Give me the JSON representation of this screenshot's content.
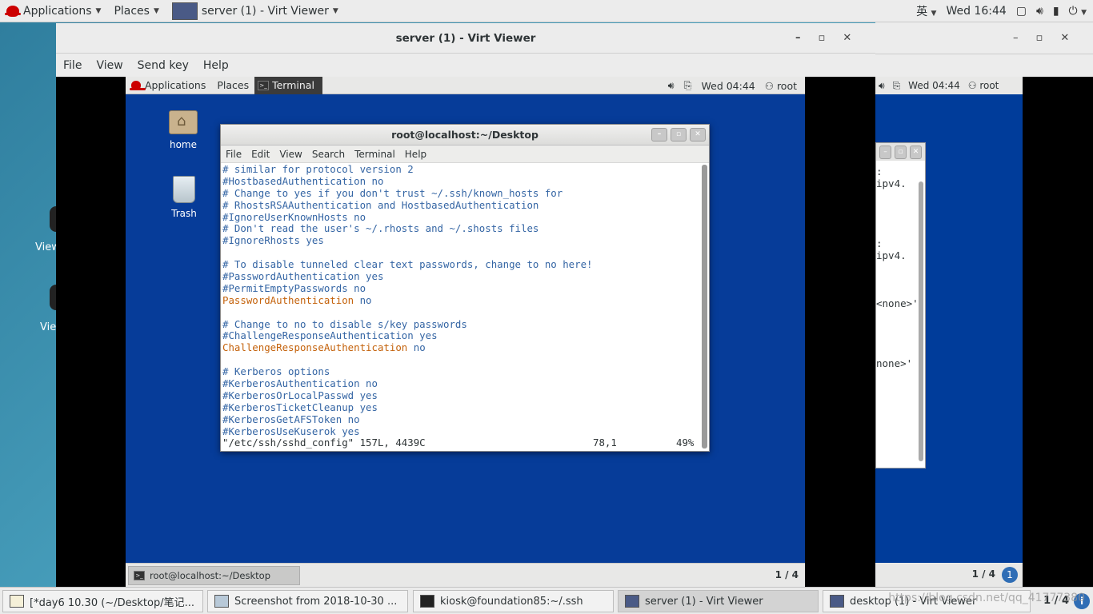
{
  "host": {
    "topbar": {
      "applications": "Applications",
      "places": "Places",
      "active_window": "server (1) - Virt Viewer",
      "input_method": "英",
      "clock": "Wed 16:44"
    },
    "desktop_fragments": [
      "View",
      "Vie"
    ],
    "taskbar": {
      "items": [
        "[*day6 10.30 (~/Desktop/笔记...",
        "Screenshot from 2018-10-30 ...",
        "kiosk@foundation85:~/.ssh",
        "server (1) - Virt Viewer",
        "desktop (1) - Virt Viewer"
      ],
      "workspace": "1 / 4",
      "watermark": "https://blog.csdn.net/qq_41777380"
    }
  },
  "viewer": {
    "title": "server (1) - Virt Viewer",
    "menu": [
      "File",
      "View",
      "Send key",
      "Help"
    ]
  },
  "guest": {
    "topbar": {
      "applications": "Applications",
      "places": "Places",
      "task": "Terminal",
      "clock": "Wed 04:44",
      "user": "root"
    },
    "desktop_icons": [
      "home",
      "Trash"
    ],
    "terminal": {
      "title": "root@localhost:~/Desktop",
      "menu": [
        "File",
        "Edit",
        "View",
        "Search",
        "Terminal",
        "Help"
      ],
      "lines": [
        {
          "k": "c",
          "t": "# similar for protocol version 2"
        },
        {
          "k": "c",
          "t": "#HostbasedAuthentication no"
        },
        {
          "k": "c",
          "t": "# Change to yes if you don't trust ~/.ssh/known_hosts for"
        },
        {
          "k": "c",
          "t": "# RhostsRSAAuthentication and HostbasedAuthentication"
        },
        {
          "k": "c",
          "t": "#IgnoreUserKnownHosts no"
        },
        {
          "k": "c",
          "t": "# Don't read the user's ~/.rhosts and ~/.shosts files"
        },
        {
          "k": "c",
          "t": "#IgnoreRhosts yes"
        },
        {
          "k": "b",
          "t": ""
        },
        {
          "k": "c",
          "t": "# To disable tunneled clear text passwords, change to no here!"
        },
        {
          "k": "c",
          "t": "#PasswordAuthentication yes"
        },
        {
          "k": "c",
          "t": "#PermitEmptyPasswords no"
        },
        {
          "k": "kv",
          "t": "PasswordAuthentication",
          "v": "no"
        },
        {
          "k": "b",
          "t": ""
        },
        {
          "k": "c",
          "t": "# Change to no to disable s/key passwords"
        },
        {
          "k": "c",
          "t": "#ChallengeResponseAuthentication yes"
        },
        {
          "k": "kv",
          "t": "ChallengeResponseAuthentication",
          "v": "no"
        },
        {
          "k": "b",
          "t": ""
        },
        {
          "k": "c",
          "t": "# Kerberos options"
        },
        {
          "k": "c",
          "t": "#KerberosAuthentication no"
        },
        {
          "k": "c",
          "t": "#KerberosOrLocalPasswd yes"
        },
        {
          "k": "c",
          "t": "#KerberosTicketCleanup yes"
        },
        {
          "k": "c",
          "t": "#KerberosGetAFSToken no"
        },
        {
          "k": "c",
          "t": "#KerberosUseKuserok yes"
        }
      ],
      "status_file": "\"/etc/ssh/sshd_config\" 157L, 4439C",
      "status_pos": "78,1",
      "status_pct": "49%",
      "scroll_position_fraction": 0.49
    },
    "taskbar": {
      "task": "root@localhost:~/Desktop",
      "workspace": "1 / 4"
    }
  },
  "viewer2": {
    "clock": "Wed 04:44",
    "user": "root",
    "workspace": "1 / 4",
    "term_fragments": [
      ": ipv4.",
      "",
      "",
      "",
      "",
      ": ipv4.",
      "",
      "",
      "",
      "<none>'",
      "",
      "",
      "",
      "",
      "none>'"
    ]
  }
}
